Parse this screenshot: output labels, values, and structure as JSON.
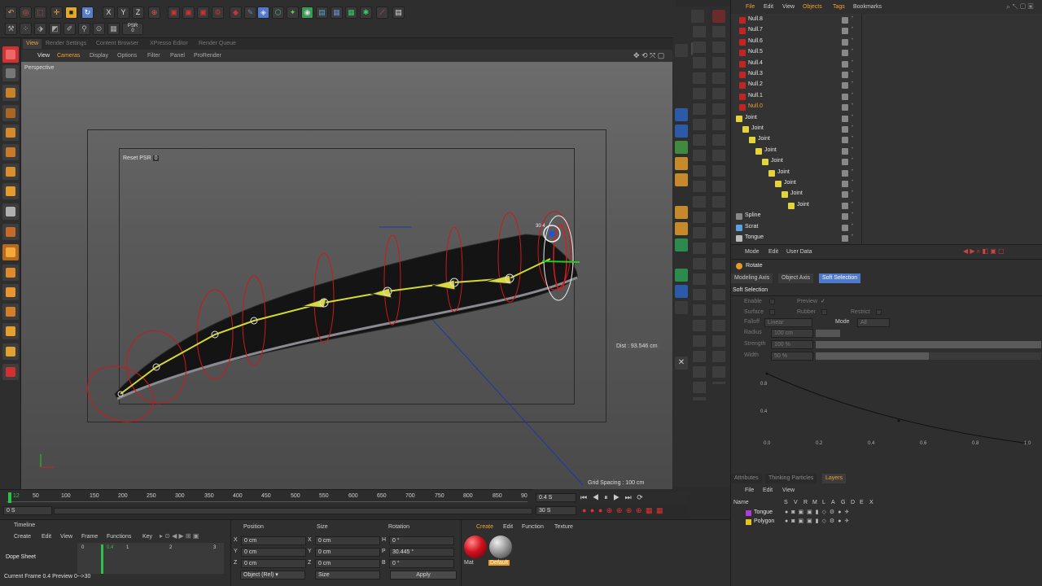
{
  "viewport_menu": {
    "items": [
      "View",
      "Cameras",
      "Display",
      "Options",
      "Filter",
      "Panel",
      "ProRender"
    ]
  },
  "viewport_tabs": [
    "View",
    "Render Settings",
    "Content Browser",
    "XPresso Editor",
    "Render Queue"
  ],
  "viewport": {
    "name": "Perspective",
    "reset_psr": "Reset PSR",
    "reset_psr_val": "0",
    "dist": "Dist : 93.546 cm",
    "grid_spacing": "Grid Spacing : 100 cm",
    "angle_readout": "30.4",
    "psr_badge": "PSR",
    "psr_value": "0"
  },
  "objects_menu": [
    "File",
    "Edit",
    "View",
    "Objects",
    "Tags",
    "Bookmarks"
  ],
  "objects": [
    {
      "name": "Null.8",
      "type": "null"
    },
    {
      "name": "Null.7",
      "type": "null"
    },
    {
      "name": "Null.6",
      "type": "null"
    },
    {
      "name": "Null.5",
      "type": "null"
    },
    {
      "name": "Null.4",
      "type": "null"
    },
    {
      "name": "Null.3",
      "type": "null"
    },
    {
      "name": "Null.2",
      "type": "null"
    },
    {
      "name": "Null.1",
      "type": "null"
    },
    {
      "name": "Null.0",
      "type": "null-selected"
    },
    {
      "name": "Joint",
      "type": "joint",
      "indent": 0
    },
    {
      "name": "Joint",
      "type": "joint",
      "indent": 1
    },
    {
      "name": "Joint",
      "type": "joint",
      "indent": 2
    },
    {
      "name": "Joint",
      "type": "joint",
      "indent": 3
    },
    {
      "name": "Joint",
      "type": "joint",
      "indent": 4
    },
    {
      "name": "Joint",
      "type": "joint",
      "indent": 5
    },
    {
      "name": "Joint",
      "type": "joint",
      "indent": 6
    },
    {
      "name": "Joint",
      "type": "joint",
      "indent": 7
    },
    {
      "name": "Joint",
      "type": "joint",
      "indent": 8
    },
    {
      "name": "Spline",
      "type": "spline"
    },
    {
      "name": "Scrat",
      "type": "scrat"
    },
    {
      "name": "Tongue",
      "type": "tongue"
    }
  ],
  "attributes": {
    "menu": [
      "Mode",
      "Edit",
      "User Data"
    ],
    "tool_name": "Rotate",
    "tabs": [
      "Modeling Axis",
      "Object Axis",
      "Soft Selection"
    ],
    "section": "Soft Selection",
    "enable_label": "Enable",
    "preview_label": "Preview",
    "preview_check": "✓",
    "surface_label": "Surface",
    "rubber_label": "Rubber",
    "restrict_label": "Restrict",
    "falloff_label": "Falloff",
    "falloff_value": "Linear",
    "mode_label": "Mode",
    "mode_value": "All",
    "radius_label": "Radius",
    "radius_value": "100 cm",
    "strength_label": "Strength",
    "strength_value": "100 %",
    "width_label": "Width",
    "width_value": "50 %",
    "strength_fill": 1.0,
    "width_fill": 0.5,
    "graph_x_ticks": [
      "0.0",
      "0.2",
      "0.4",
      "0.6",
      "0.8",
      "1.0"
    ],
    "graph_y_ticks": [
      "0.8",
      "0.4"
    ]
  },
  "layers": {
    "tabs": [
      "Attributes",
      "Thinking Particles",
      "Layers"
    ],
    "menu": [
      "File",
      "Edit",
      "View"
    ],
    "header_name": "Name",
    "header_cols": [
      "S",
      "V",
      "R",
      "M",
      "L",
      "A",
      "G",
      "D",
      "E",
      "X"
    ],
    "rows": [
      {
        "name": "Tongue",
        "color": "#b23ad6"
      },
      {
        "name": "Polygon",
        "color": "#e5c51a"
      }
    ]
  },
  "timeline": {
    "ticks": [
      "0",
      "12",
      "50",
      "100",
      "150",
      "200",
      "250",
      "300",
      "350",
      "400",
      "450",
      "500",
      "550",
      "600",
      "650",
      "700",
      "750",
      "800",
      "850",
      "90"
    ],
    "current_frame_field": "0.4 S",
    "start_field": "0 S",
    "start_field2": "0 S",
    "end_field": "30 S",
    "end_field2": "30 S"
  },
  "dope": {
    "title": "Timeline",
    "menu": [
      "Create",
      "Edit",
      "View",
      "Frame",
      "Functions",
      "Key"
    ],
    "sheet_label": "Dope Sheet",
    "ticks": [
      "0",
      "0.4",
      "1",
      "2",
      "3"
    ],
    "status": "Current Frame  0.4  Preview  0-->30"
  },
  "coords": {
    "headers": [
      "Position",
      "Size",
      "Rotation"
    ],
    "rows": [
      {
        "axis": "X",
        "pos": "0 cm",
        "size_axis": "X",
        "size": "0 cm",
        "rot_axis": "H",
        "rot": "0 °"
      },
      {
        "axis": "Y",
        "pos": "0 cm",
        "size_axis": "Y",
        "size": "0 cm",
        "rot_axis": "P",
        "rot": "30.445 °"
      },
      {
        "axis": "Z",
        "pos": "0 cm",
        "size_axis": "Z",
        "size": "0 cm",
        "rot_axis": "B",
        "rot": "0 °"
      }
    ],
    "mode_select": "Object (Rel)",
    "size_select": "Size",
    "apply": "Apply"
  },
  "materials": {
    "menu": [
      "Create",
      "Edit",
      "Function",
      "Texture"
    ],
    "items": [
      {
        "name": "Mat",
        "color": "#d01020"
      },
      {
        "name": "Default",
        "color": "#9a9a9a"
      }
    ]
  }
}
